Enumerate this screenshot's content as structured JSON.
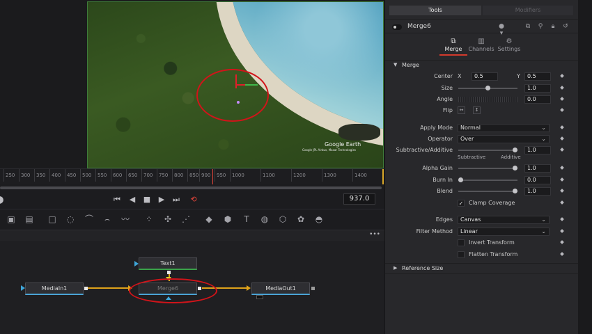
{
  "viewer": {
    "watermark": "Google Earth",
    "watermark_sub": "Google JPL Airbus, Maxar Technologies"
  },
  "ruler": {
    "ticks": [
      "250",
      "300",
      "350",
      "400",
      "450",
      "500",
      "550",
      "600",
      "650",
      "700",
      "750",
      "800",
      "850",
      "900",
      "950",
      "1000",
      "1100",
      "1200",
      "1300",
      "1400"
    ]
  },
  "transport": {
    "timecode": "937.0",
    "buttons": [
      "skip-start-icon",
      "step-back-icon",
      "stop-icon",
      "play-icon",
      "skip-end-icon",
      "loop-icon"
    ]
  },
  "toolbar": {
    "tools": [
      "background-tool-icon",
      "image-tool-icon",
      "rectangle-mask-icon",
      "ellipse-mask-icon",
      "polygon-mask-icon",
      "bspline-mask-icon",
      "paint-icon",
      "particles-icon",
      "tracker-icon",
      "merge-icon",
      "shape3d-icon",
      "text3d-icon",
      "camera3d-icon",
      "renderer3d-icon",
      "spotlight-icon",
      "merge3d-icon"
    ]
  },
  "nodegraph": {
    "more": "•••",
    "nodes": {
      "text1": "Text1",
      "mediain1": "MediaIn1",
      "merge6": "Merge6",
      "mediaout1": "MediaOut1"
    }
  },
  "inspector": {
    "tabs": {
      "tools": "Tools",
      "modifiers": "Modifiers"
    },
    "node_name": "Merge6",
    "header_icons": [
      "color-dot-icon",
      "version-icon",
      "pin-icon",
      "lock-icon",
      "reset-icon"
    ],
    "subtabs": [
      {
        "label": "Merge",
        "icon": "merge-tab-icon",
        "active": true
      },
      {
        "label": "Channels",
        "icon": "channels-tab-icon",
        "active": false
      },
      {
        "label": "Settings",
        "icon": "settings-tab-icon",
        "active": false
      }
    ],
    "section": "Merge",
    "center": {
      "label": "Center",
      "x_label": "X",
      "x": "0.5",
      "y_label": "Y",
      "y": "0.5"
    },
    "size": {
      "label": "Size",
      "value": "1.0",
      "slider": 0.5
    },
    "angle": {
      "label": "Angle",
      "value": "0.0"
    },
    "flip": {
      "label": "Flip"
    },
    "apply_mode": {
      "label": "Apply Mode",
      "value": "Normal"
    },
    "operator": {
      "label": "Operator",
      "value": "Over"
    },
    "sub_add": {
      "label": "Subtractive/Additive",
      "value": "1.0",
      "left": "Subtractive",
      "right": "Additive",
      "slider": 1.0
    },
    "alpha_gain": {
      "label": "Alpha Gain",
      "value": "1.0",
      "slider": 1.0
    },
    "burn_in": {
      "label": "Burn In",
      "value": "0.0",
      "slider": 0.0
    },
    "blend": {
      "label": "Blend",
      "value": "1.0",
      "slider": 1.0
    },
    "clamp": {
      "label": "Clamp Coverage",
      "checked": true
    },
    "edges": {
      "label": "Edges",
      "value": "Canvas"
    },
    "filter": {
      "label": "Filter Method",
      "value": "Linear"
    },
    "invert": {
      "label": "Invert Transform",
      "checked": false
    },
    "flatten": {
      "label": "Flatten Transform",
      "checked": false
    },
    "reference": "Reference Size"
  }
}
